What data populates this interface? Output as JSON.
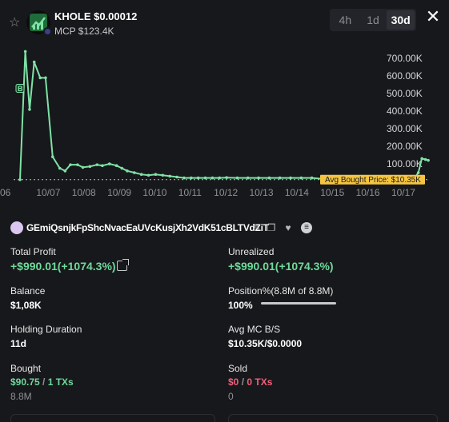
{
  "header": {
    "title": "KHOLE $0.00012",
    "mcp": "MCP $123.4K",
    "tabs": [
      "4h",
      "1d",
      "30d"
    ],
    "active_tab": "30d",
    "close_glyph": "✕",
    "star_glyph": "☆"
  },
  "chart_data": {
    "type": "line",
    "y_ticks": [
      "700.00K",
      "600.00K",
      "500.00K",
      "400.00K",
      "300.00K",
      "200.00K",
      "100.00K"
    ],
    "x_ticks": [
      "06",
      "10/07",
      "10/08",
      "10/09",
      "10/10",
      "10/11",
      "10/12",
      "10/13",
      "10/14",
      "10/15",
      "10/16",
      "10/17"
    ],
    "ylim": [
      0,
      760000
    ],
    "xlim": [
      6.0,
      17.7
    ],
    "buy_marker": "B",
    "buy_marker_x": 6.18,
    "buy_marker_y": 530000,
    "avg_bought_label": "Avg Bought Price: $10.35K",
    "avg_bought_value": 10350,
    "line_color": "#7ee2a6",
    "x": [
      6.18,
      6.33,
      6.45,
      6.58,
      6.75,
      6.9,
      7.1,
      7.3,
      7.45,
      7.6,
      7.8,
      7.95,
      8.15,
      8.35,
      8.5,
      8.7,
      8.9,
      9.05,
      9.2,
      9.4,
      9.6,
      9.8,
      10.0,
      10.2,
      10.4,
      10.6,
      10.8,
      11.0,
      11.2,
      11.4,
      11.6,
      11.8,
      12.0,
      12.3,
      12.6,
      12.9,
      13.2,
      13.5,
      13.8,
      14.1,
      14.4,
      14.7,
      15.0,
      15.3,
      15.6,
      15.9,
      16.2,
      16.5,
      16.8,
      17.1,
      17.28,
      17.4,
      17.5,
      17.6,
      17.68
    ],
    "y": [
      10000,
      740000,
      410000,
      680000,
      590000,
      590000,
      140000,
      75000,
      60000,
      95000,
      95000,
      80000,
      85000,
      95000,
      90000,
      100000,
      90000,
      75000,
      60000,
      50000,
      40000,
      35000,
      40000,
      35000,
      30000,
      25000,
      20000,
      20000,
      20000,
      20000,
      20000,
      20000,
      22000,
      20000,
      20000,
      20000,
      20000,
      20000,
      20000,
      20000,
      20000,
      15000,
      15000,
      15000,
      15000,
      15000,
      15000,
      15000,
      15000,
      15000,
      15000,
      50000,
      130000,
      125000,
      120000
    ]
  },
  "wallet": {
    "address": "GEmiQsnjkFpShcNvacEaUVcKusjXh2VdK51cBLTVdZiT",
    "icons": [
      "edit-icon",
      "copy-icon",
      "heart-icon",
      "menu-icon"
    ]
  },
  "stats": {
    "total_profit_label": "Total Profit",
    "total_profit_value": "+$990.01(+1074.3%)",
    "unrealized_label": "Unrealized",
    "unrealized_value": "+$990.01(+1074.3%)",
    "balance_label": "Balance",
    "balance_value": "$1,08K",
    "position_label": "Position%(8.8M of 8.8M)",
    "position_value": "100%",
    "position_fraction": 1.0,
    "holding_label": "Holding Duration",
    "holding_value": "11d",
    "avg_mc_label": "Avg MC B/S",
    "avg_mc_value": "$10.35K/$0.0000",
    "bought_label": "Bought",
    "bought_amount": "$90.75",
    "bought_sep": " / ",
    "bought_txs": "1 TXs",
    "bought_tokens": "8.8M",
    "sold_label": "Sold",
    "sold_amount": "$0",
    "sold_sep": " / ",
    "sold_txs": "0 TXs",
    "sold_tokens": "0"
  },
  "colors": {
    "background": "#17181b",
    "green": "#6fd99b",
    "red": "#f0607b",
    "avg_label_bg": "#f5c542"
  }
}
